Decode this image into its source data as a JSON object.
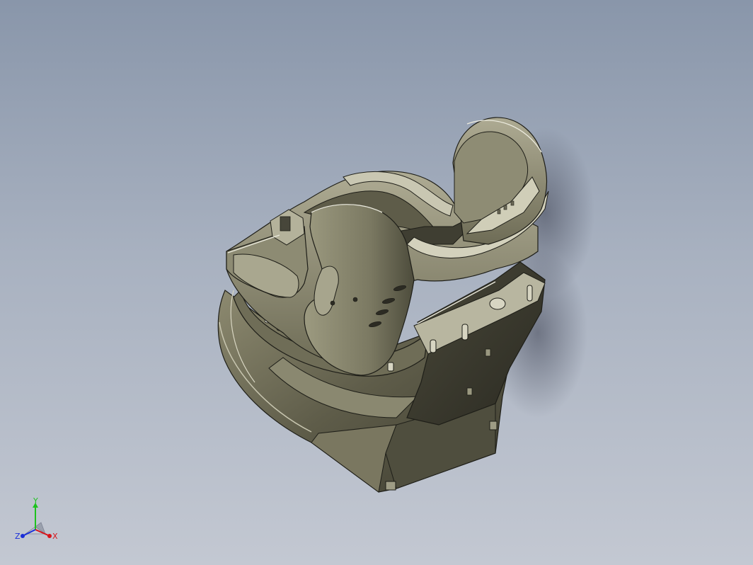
{
  "viewport": {
    "background_top": "#8996aa",
    "background_bottom": "#c3c8d2",
    "model_name": "child-car-seat-model"
  },
  "triad": {
    "x_label": "X",
    "y_label": "Y",
    "z_label": "Z",
    "x_color": "#d8141a",
    "y_color": "#1ec21e",
    "z_color": "#1a2fd8"
  }
}
